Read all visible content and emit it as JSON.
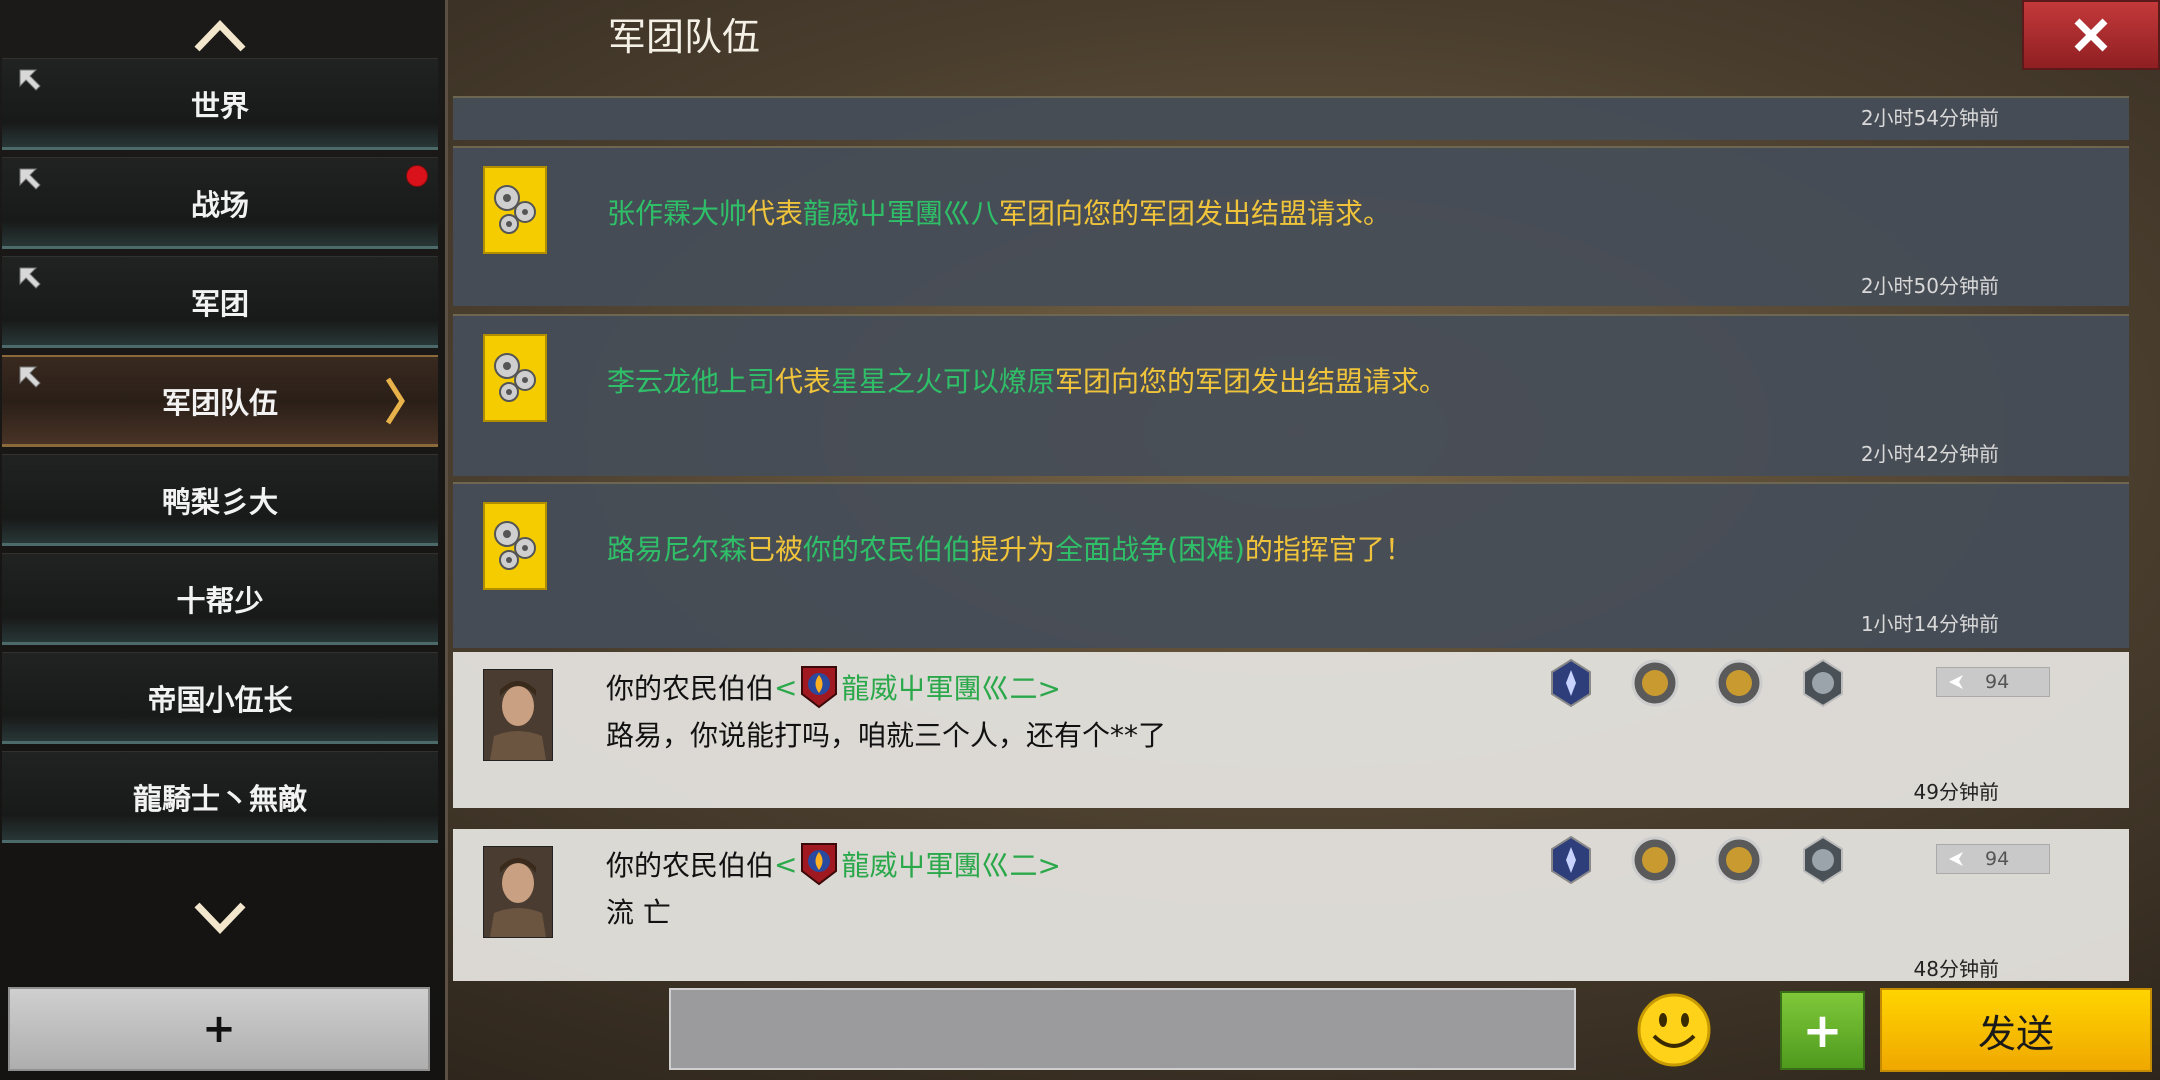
{
  "title": "军团队伍",
  "sidebar": {
    "channels": [
      {
        "label": "世界",
        "pinned": true
      },
      {
        "label": "战场",
        "pinned": true,
        "unread": true
      },
      {
        "label": "军团",
        "pinned": true
      },
      {
        "label": "军团队伍",
        "pinned": true,
        "active": true
      },
      {
        "label": "鸭梨彡大",
        "pinned": false
      },
      {
        "label": "十帮少",
        "pinned": false
      },
      {
        "label": "帝国小伍长",
        "pinned": false
      },
      {
        "label": "龍騎士丶無敵",
        "pinned": false
      }
    ],
    "add_label": "+"
  },
  "messages": {
    "top_time": "2小时54分钟前",
    "sys1": {
      "name": "张作霖大帅",
      "t1": "代表",
      "legion": "龍威屮軍團巛八",
      "t2": "军团向您的军团发出结盟请求。",
      "time": "2小时50分钟前"
    },
    "sys2": {
      "name": "李云龙他上司",
      "t1": "代表",
      "legion": "星星之火可以燎原",
      "t2": "军团向您的军团发出结盟请求。",
      "time": "2小时42分钟前"
    },
    "sys3": {
      "name": "路易尼尔森",
      "t1": "已被",
      "promoter": "你的农民伯伯",
      "t2": "提升为",
      "role": "全面战争(困难)",
      "t3": "的指挥官了！",
      "time": "1小时14分钟前"
    },
    "chat1": {
      "sender": "你的农民伯伯",
      "lt": "<",
      "legion": "龍威屮軍團巛二>",
      "text": "路易，你说能打吗，咱就三个人，还有个**了",
      "level": "94",
      "time": "49分钟前"
    },
    "chat2": {
      "sender": "你的农民伯伯",
      "lt": "<",
      "legion": "龍威屮軍團巛二>",
      "text": "流 亡",
      "level": "94",
      "time": "48分钟前"
    }
  },
  "input": {
    "placeholder": "",
    "value": ""
  },
  "buttons": {
    "plus": "+",
    "send": "发送"
  },
  "colors": {
    "name_green": "#2fbf68",
    "text_yellow": "#f0c43a",
    "send_yellow": "#ffd400",
    "close_red": "#c3393a",
    "plus_green": "#7fc83a"
  }
}
